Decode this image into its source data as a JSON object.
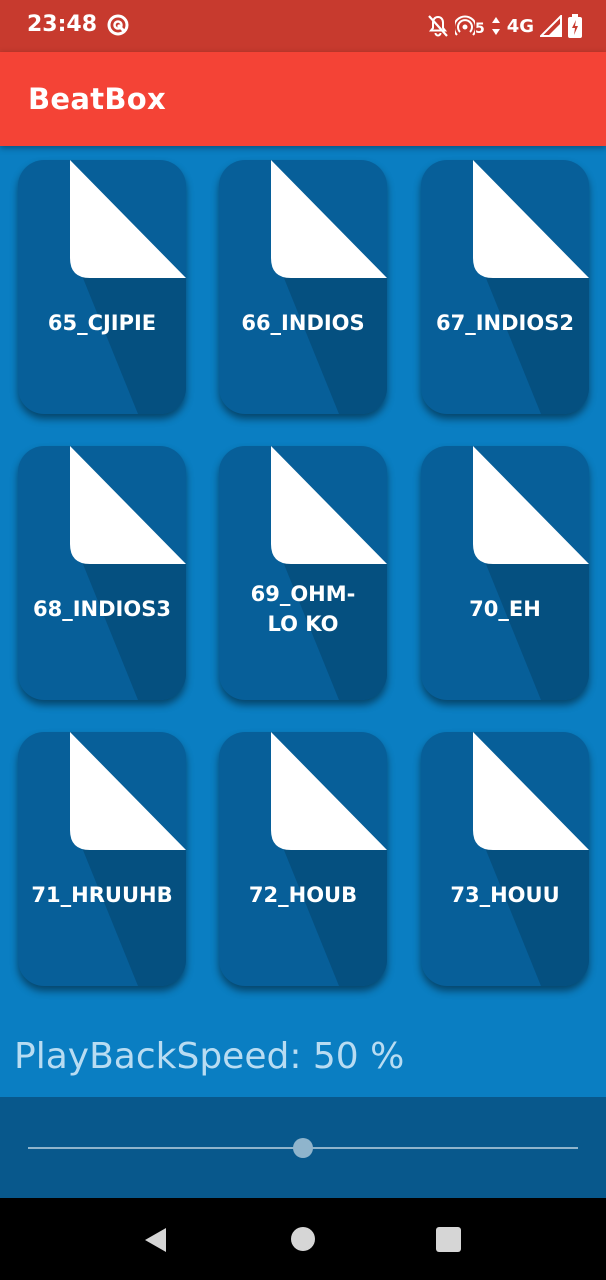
{
  "status_bar": {
    "time": "23:48",
    "network": "4G",
    "left_icon": "sync-circle-icon",
    "right_icons": [
      "notifications-off-icon",
      "hotspot-icon",
      "signal-icon",
      "battery-icon"
    ],
    "hotspot_count": "5"
  },
  "app_bar": {
    "title": "BeatBox",
    "color": "#f44336"
  },
  "sounds": [
    {
      "label": "65_CJIPIE"
    },
    {
      "label": "66_INDIOS"
    },
    {
      "label": "67_INDIOS2"
    },
    {
      "label": "68_INDIOS3"
    },
    {
      "label": "69_OHM-LO KO"
    },
    {
      "label": "70_EH"
    },
    {
      "label": "71_HRUUHB"
    },
    {
      "label": "72_HOUB"
    },
    {
      "label": "73_HOUU"
    }
  ],
  "playback": {
    "label": "PlayBackSpeed: 50 %",
    "slider_fraction": 0.5
  },
  "nav_bar": {
    "icons": [
      "back-icon",
      "home-icon",
      "recents-icon"
    ]
  },
  "colors": {
    "background": "#0a7ec2",
    "tile": "#075f99",
    "status_bar": "#c73a2e"
  }
}
